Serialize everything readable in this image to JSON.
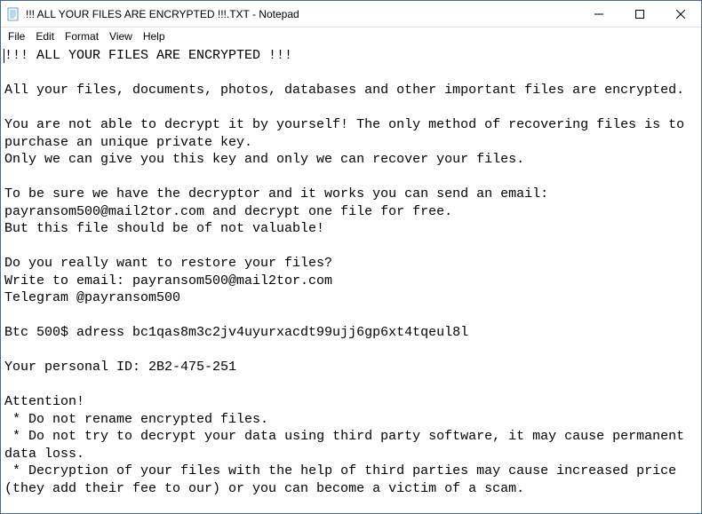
{
  "titlebar": {
    "title": "!!! ALL YOUR FILES ARE ENCRYPTED !!!.TXT - Notepad"
  },
  "menubar": {
    "file": "File",
    "edit": "Edit",
    "format": "Format",
    "view": "View",
    "help": "Help"
  },
  "content": {
    "text": "!!! ALL YOUR FILES ARE ENCRYPTED !!!\n\nAll your files, documents, photos, databases and other important files are encrypted.\n\nYou are not able to decrypt it by yourself! The only method of recovering files is to purchase an unique private key.\nOnly we can give you this key and only we can recover your files.\n\nTo be sure we have the decryptor and it works you can send an email: payransom500@mail2tor.com and decrypt one file for free.\nBut this file should be of not valuable!\n\nDo you really want to restore your files?\nWrite to email: payransom500@mail2tor.com\nTelegram @payransom500\n\nBtc 500$ adress bc1qas8m3c2jv4uyurxacdt99ujj6gp6xt4tqeul8l\n\nYour personal ID: 2B2-475-251\n\nAttention!\n * Do not rename encrypted files.\n * Do not try to decrypt your data using third party software, it may cause permanent data loss.\n * Decryption of your files with the help of third parties may cause increased price (they add their fee to our) or you can become a victim of a scam."
  }
}
